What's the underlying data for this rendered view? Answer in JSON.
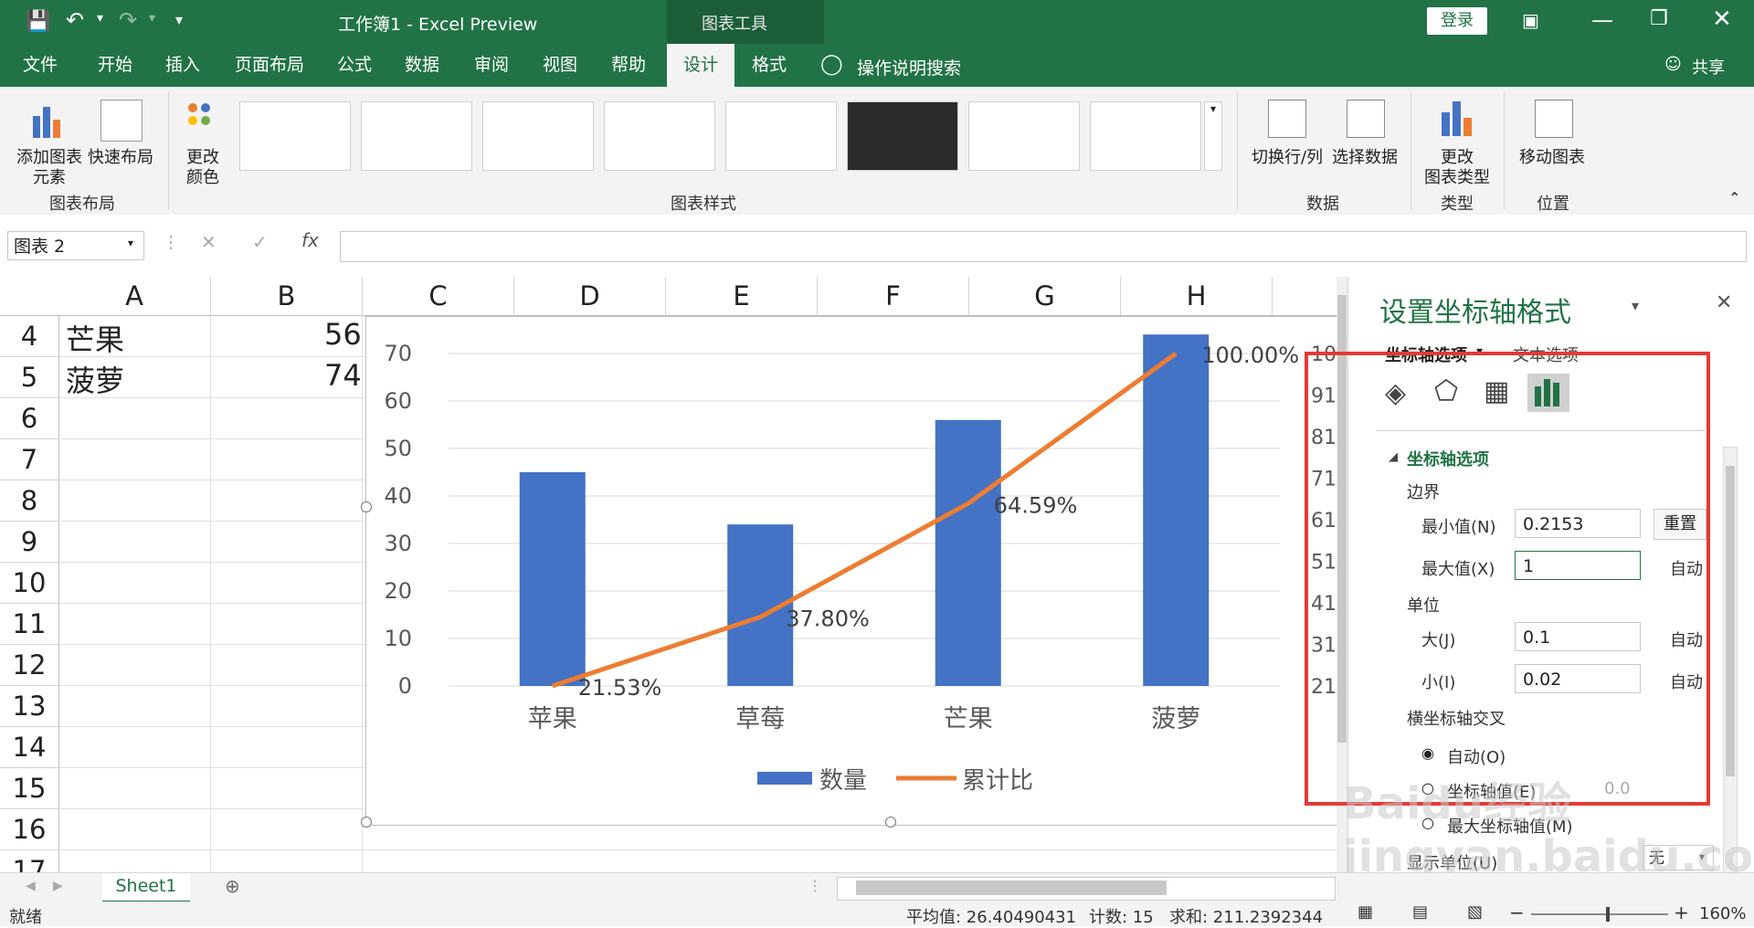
{
  "titlebar": {
    "workbook_title": "工作簿1  -  Excel Preview",
    "context_tab": "图表工具",
    "login_label": "登录"
  },
  "tabs": [
    "文件",
    "开始",
    "插入",
    "页面布局",
    "公式",
    "数据",
    "审阅",
    "视图",
    "帮助",
    "设计",
    "格式"
  ],
  "active_tab": "设计",
  "tell_me": "操作说明搜索",
  "share_label": "共享",
  "ribbon": {
    "add_element_line1": "添加图表",
    "add_element_line2": "元素",
    "quick_layout": "快速布局",
    "change_colors_line1": "更改",
    "change_colors_line2": "颜色",
    "group_chart_layout": "图表布局",
    "group_chart_styles": "图表样式",
    "switch_row_col": "切换行/列",
    "select_data": "选择数据",
    "group_data": "数据",
    "change_type_line1": "更改",
    "change_type_line2": "图表类型",
    "group_type": "类型",
    "move_chart": "移动图表",
    "group_location": "位置"
  },
  "formula": {
    "name_box": "图表 2",
    "cancel_symbol": "✕",
    "enter_symbol": "✓",
    "fx_symbol": "fx",
    "formula_value": ""
  },
  "columns": [
    "A",
    "B",
    "C",
    "D",
    "E",
    "F",
    "G",
    "H"
  ],
  "rows": [
    "4",
    "5",
    "6",
    "7",
    "8",
    "9",
    "10",
    "11",
    "12",
    "13",
    "14",
    "15",
    "16",
    "17"
  ],
  "cells": {
    "a4": "芒果",
    "b4": "56",
    "a5": "菠萝",
    "b5": "74"
  },
  "chart_data": {
    "type": "bar",
    "categories": [
      "苹果",
      "草莓",
      "芒果",
      "菠萝"
    ],
    "series": [
      {
        "name": "数量",
        "values": [
          45,
          34,
          56,
          74
        ]
      },
      {
        "name": "累计比",
        "values": [
          21.53,
          37.8,
          64.59,
          100.0
        ],
        "type": "line"
      }
    ],
    "data_labels": [
      "21.53%",
      "37.80%",
      "64.59%",
      "100.00%"
    ],
    "y_ticks": [
      "0",
      "10",
      "20",
      "30",
      "40",
      "50",
      "60",
      "70"
    ],
    "ylim": [
      0,
      70
    ],
    "secondary_ylim": [
      0.2153,
      1
    ],
    "secondary_ticks_partial": [
      "21",
      "31",
      "41",
      "51",
      "61",
      "71",
      "81",
      "91",
      "10"
    ],
    "legend_position": "bottom",
    "colors": {
      "bar": "#4472c4",
      "line": "#ed7d31"
    }
  },
  "pane": {
    "title": "设置坐标轴格式",
    "tab_axis_options": "坐标轴选项",
    "tab_text_options": "文本选项",
    "section_title": "坐标轴选项",
    "bounds": "边界",
    "min_label": "最小值(N)",
    "min_value": "0.2153",
    "reset_label": "重置",
    "max_label": "最大值(X)",
    "max_value": "1",
    "auto1": "自动",
    "units": "单位",
    "major_label": "大(J)",
    "major_value": "0.1",
    "auto2": "自动",
    "minor_label": "小(I)",
    "minor_value": "0.02",
    "auto3": "自动",
    "cross_title": "横坐标轴交叉",
    "cross_auto": "自动(O)",
    "cross_value": "坐标轴值(E)",
    "cross_value_num": "0.0",
    "cross_max": "最大坐标轴值(M)",
    "display_units": "显示单位(U)",
    "display_units_value": "无"
  },
  "sheet_tab": "Sheet1",
  "status": {
    "ready": "就绪",
    "average": "平均值: 26.40490431",
    "count": "计数: 15",
    "sum": "求和: 211.2392344",
    "zoom": "160%"
  },
  "watermark": "Baidu经验  jingyan.baidu.com"
}
